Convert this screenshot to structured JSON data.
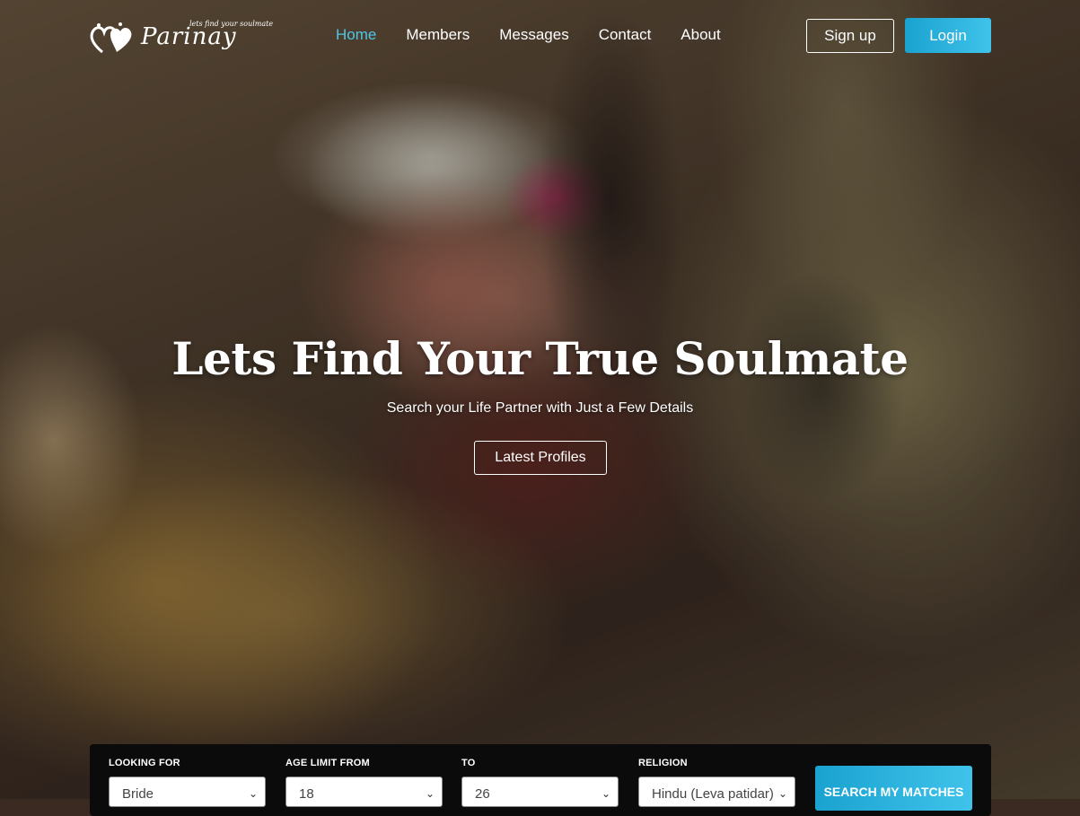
{
  "brand": {
    "name": "Parinay",
    "tagline": "lets find your soulmate"
  },
  "nav": {
    "items": [
      {
        "label": "Home",
        "active": true
      },
      {
        "label": "Members",
        "active": false
      },
      {
        "label": "Messages",
        "active": false
      },
      {
        "label": "Contact",
        "active": false
      },
      {
        "label": "About",
        "active": false
      }
    ]
  },
  "auth": {
    "signup_label": "Sign up",
    "login_label": "Login"
  },
  "hero": {
    "title": "Lets Find Your True Soulmate",
    "subtitle": "Search your Life Partner with Just a Few Details",
    "cta_label": "Latest Profiles"
  },
  "search": {
    "looking_for": {
      "label": "LOOKING FOR",
      "value": "Bride"
    },
    "age_from": {
      "label": "AGE LIMIT FROM",
      "value": "18"
    },
    "age_to": {
      "label": "TO",
      "value": "26"
    },
    "religion": {
      "label": "RELIGION",
      "value": "Hindu (Leva patidar)"
    },
    "submit_label": "SEARCH MY MATCHES"
  },
  "colors": {
    "accent": "#3fc3ea",
    "active_nav": "#4cc6e8",
    "panel_bg": "#0b0b0b"
  },
  "icons": [
    "hearts-logo-icon",
    "chevron-down-icon"
  ]
}
